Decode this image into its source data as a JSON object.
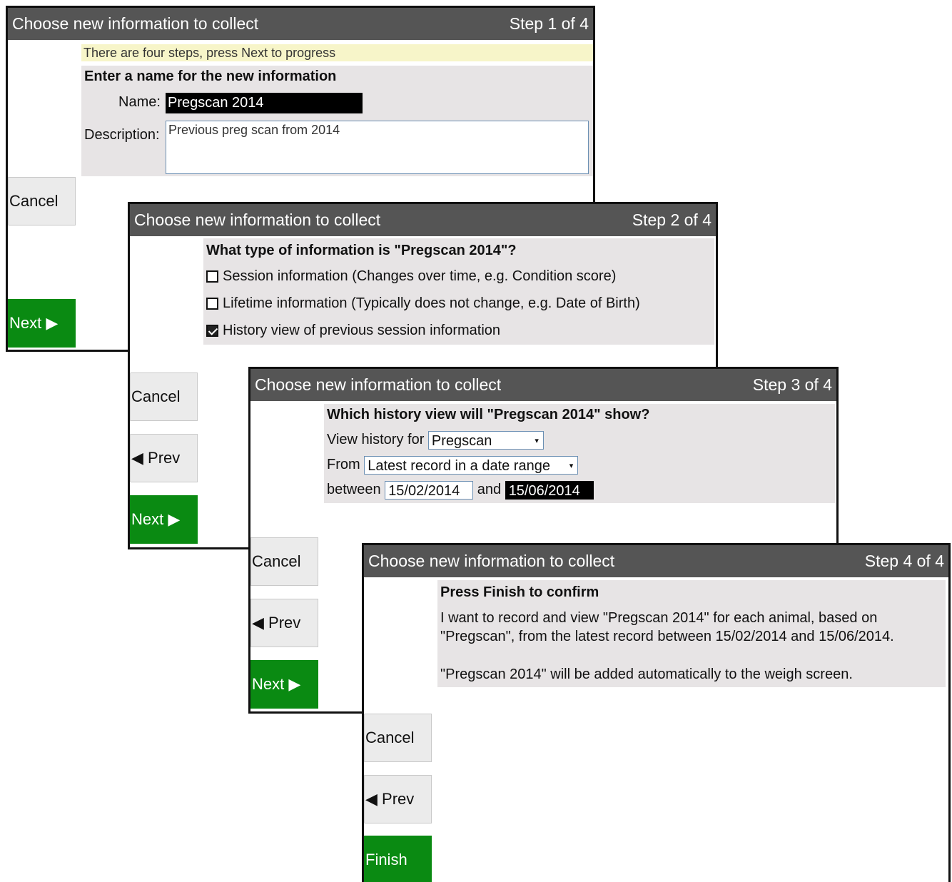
{
  "window_title": "Choose new information to collect",
  "buttons": {
    "cancel": "Cancel",
    "prev": "◀ Prev",
    "next": "Next ▶",
    "finish": "Finish"
  },
  "step1": {
    "step_label": "Step 1 of 4",
    "hint": "There are four steps, press Next to progress",
    "heading": "Enter a name for the new information",
    "name_label": "Name:",
    "name_value": "Pregscan 2014",
    "description_label": "Description:",
    "description_value": "Previous preg scan from 2014"
  },
  "step2": {
    "step_label": "Step 2 of 4",
    "heading": "What type of information is \"Pregscan 2014\"?",
    "options": [
      {
        "label": "Session information (Changes over time, e.g. Condition score)",
        "checked": false
      },
      {
        "label": "Lifetime information (Typically does not change, e.g. Date of Birth)",
        "checked": false
      },
      {
        "label": "History view of previous session information",
        "checked": true
      }
    ]
  },
  "step3": {
    "step_label": "Step 3 of 4",
    "heading": "Which history view will \"Pregscan 2014\" show?",
    "view_history_label": "View history for",
    "view_history_value": "Pregscan",
    "from_label": "From",
    "from_value": "Latest record in a date range",
    "between_label": "between",
    "date_start": "15/02/2014",
    "and_label": "and",
    "date_end": "15/06/2014"
  },
  "step4": {
    "step_label": "Step 4 of 4",
    "heading": "Press Finish to confirm",
    "summary_line1": "I want to record and view \"Pregscan 2014\" for each animal, based on",
    "summary_line2": "\"Pregscan\", from the latest record between 15/02/2014 and 15/06/2014.",
    "summary_line3": "\"Pregscan 2014\" will be added automatically to the weigh screen."
  },
  "colors": {
    "titlebar": "#555555",
    "panel": "#e7e4e5",
    "hint": "#f7f5c9",
    "green_button": "#0a8a12"
  },
  "icons": {
    "prev": "left-triangle-icon",
    "next": "right-triangle-icon",
    "dropdown": "dropdown-caret-icon",
    "checkbox": "checkbox-icon"
  }
}
